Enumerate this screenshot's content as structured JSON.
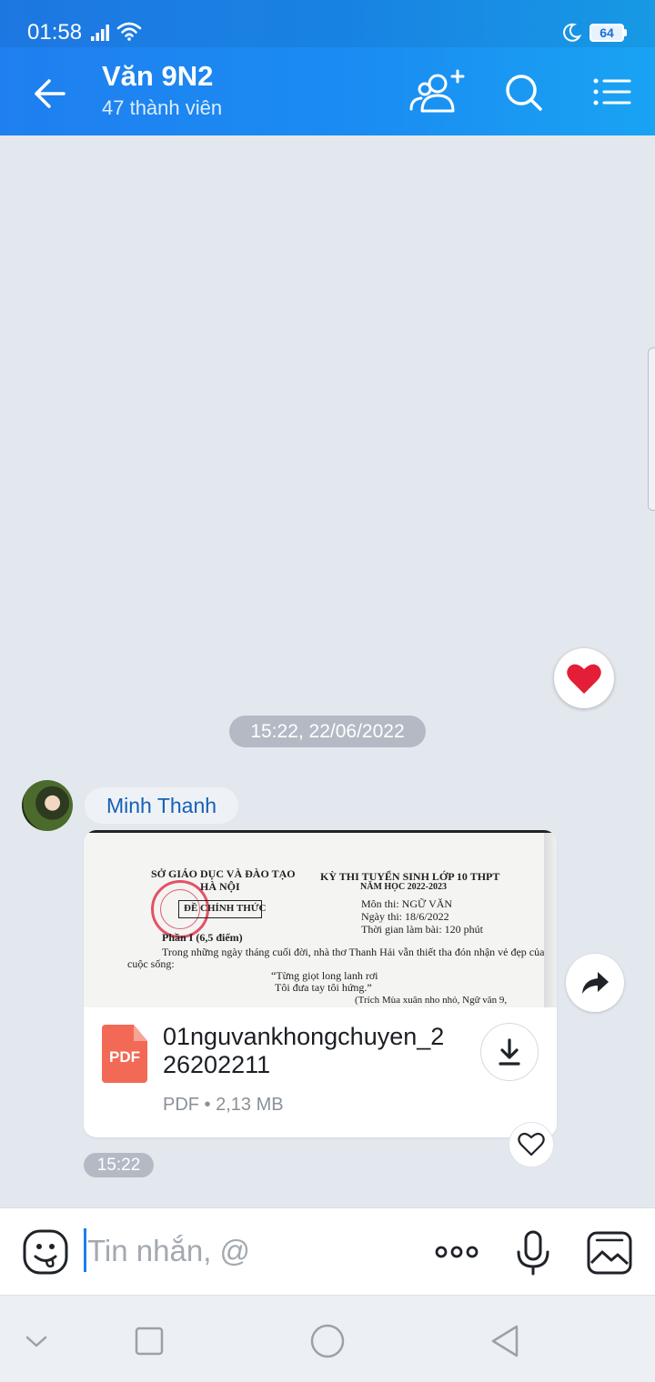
{
  "status_bar": {
    "time": "01:58",
    "battery": "64"
  },
  "header": {
    "title": "Văn 9N2",
    "subtitle": "47 thành viên"
  },
  "chat": {
    "date_separator": "15:22, 22/06/2022",
    "message": {
      "sender": "Minh Thanh",
      "time": "15:22",
      "file": {
        "name": "01nguvankhongchuyen_226202211",
        "type_label": "PDF",
        "meta": "PDF • 2,13 MB",
        "preview": {
          "left_line1": "SỞ GIÁO DỤC VÀ ĐÀO TẠO",
          "left_line2": "HÀ NỘI",
          "boxed": "ĐỀ CHÍNH THỨC",
          "right_line1": "KỲ THI TUYỂN SINH LỚP 10 THPT",
          "right_line2": "NĂM HỌC 2022-2023",
          "mon_thi": "Môn thi: NGỮ VĂN",
          "ngay_thi": "Ngày thi: 18/6/2022",
          "thoi_gian": "Thời gian làm bài: 120 phút",
          "phan1": "Phần I (6,5 điểm)",
          "para1": "Trong những ngày tháng cuối đời, nhà thơ Thanh Hải vẫn thiết tha đón nhận vẻ đẹp của",
          "para2": "cuộc sống:",
          "quote1": "“Từng giọt long lanh rơi",
          "quote2": "Tôi đưa tay tôi hứng.”",
          "source": "(Trích Mùa xuân nho nhỏ, Ngữ văn 9,"
        }
      }
    }
  },
  "input": {
    "placeholder": "Tin nhắn, @"
  },
  "colors": {
    "header_start": "#1f7ff0",
    "header_end": "#19a3f3",
    "accent": "#1560b4",
    "pdf": "#f26a55"
  }
}
